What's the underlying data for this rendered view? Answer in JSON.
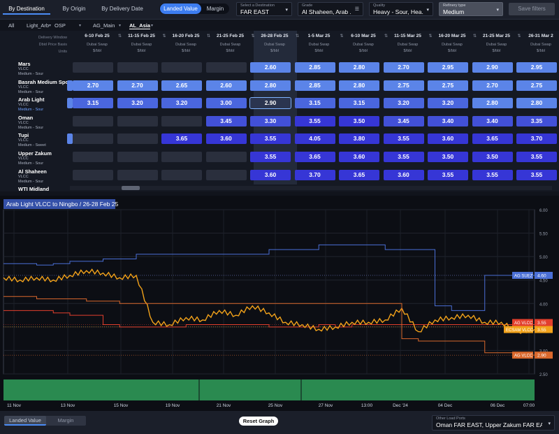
{
  "nav": {
    "by_destination": "By Destination",
    "by_origin": "By Origin",
    "by_delivery_date": "By Delivery Date",
    "landed_value": "Landed Value",
    "margin": "Margin",
    "select_destination_label": "Select a Destination",
    "select_destination_value": "FAR EAST",
    "grade_label": "Grade",
    "grade_value": "Al Shaheen, Arab ...",
    "quality_label": "Quality",
    "quality_value": "Heavy - Sour, Hea...",
    "refinery_label": "Refinery type",
    "refinery_value": "Medium",
    "save_filters": "Save filters"
  },
  "filter_tabs": [
    "All",
    "Light_Arb",
    "OSP",
    "AG_Main",
    "AL_Asia"
  ],
  "grid": {
    "row_header_labels": [
      "Delivery Window",
      "Dbid Price Basis",
      "Units"
    ],
    "columns": [
      {
        "date": "6-10 Feb 25",
        "basis": "Dubai Swap",
        "units": "$/bbl"
      },
      {
        "date": "11-15 Feb 25",
        "basis": "Dubai Swap",
        "units": "$/bbl"
      },
      {
        "date": "16-20 Feb 25",
        "basis": "Dubai Swap",
        "units": "$/bbl"
      },
      {
        "date": "21-25 Feb 25",
        "basis": "Dubai Swap",
        "units": "$/bbl"
      },
      {
        "date": "26-28 Feb 25",
        "basis": "Dubai Swap",
        "units": "$/bbl"
      },
      {
        "date": "1-5 Mar 25",
        "basis": "Dubai Swap",
        "units": "$/bbl"
      },
      {
        "date": "6-10 Mar 25",
        "basis": "Dubai Swap",
        "units": "$/bbl"
      },
      {
        "date": "11-15 Mar 25",
        "basis": "Dubai Swap",
        "units": "$/bbl"
      },
      {
        "date": "16-20 Mar 25",
        "basis": "Dubai Swap",
        "units": "$/bbl"
      },
      {
        "date": "21-25 Mar 25",
        "basis": "Dubai Swap",
        "units": "$/bbl"
      },
      {
        "date": "26-31 Mar 2",
        "basis": "Dubai Swap",
        "units": "$/bbl"
      }
    ],
    "rows": [
      {
        "name": "Mars",
        "type": "VLCC",
        "quality": "Medium - Sour",
        "values": [
          "",
          "",
          "",
          "",
          "2.60",
          "2.85",
          "2.80",
          "2.70",
          "2.95",
          "2.90",
          "2.95"
        ]
      },
      {
        "name": "Basrah Medium Spot",
        "type": "VLCC",
        "quality": "Medium - Sour",
        "values": [
          "2.70",
          "2.70",
          "2.65",
          "2.60",
          "2.80",
          "2.85",
          "2.80",
          "2.75",
          "2.75",
          "2.70",
          "2.75"
        ]
      },
      {
        "name": "Arab Light",
        "type": "VLCC",
        "quality": "Medium - Sour",
        "values": [
          "3.15",
          "3.20",
          "3.20",
          "3.00",
          "2.90",
          "3.15",
          "3.15",
          "3.20",
          "3.20",
          "2.80",
          "2.80"
        ]
      },
      {
        "name": "Oman",
        "type": "VLCC",
        "quality": "Medium - Sour",
        "values": [
          "",
          "",
          "",
          "3.45",
          "3.30",
          "3.55",
          "3.50",
          "3.45",
          "3.40",
          "3.40",
          "3.35"
        ]
      },
      {
        "name": "Tupi",
        "type": "VLCC",
        "quality": "Medium - Sweet",
        "values": [
          "",
          "",
          "3.65",
          "3.60",
          "3.55",
          "4.05",
          "3.80",
          "3.55",
          "3.60",
          "3.65",
          "3.70"
        ]
      },
      {
        "name": "Upper Zakum",
        "type": "VLCC",
        "quality": "Medium - Sour",
        "values": [
          "",
          "",
          "",
          "",
          "3.55",
          "3.65",
          "3.60",
          "3.55",
          "3.50",
          "3.50",
          "3.55"
        ]
      },
      {
        "name": "Al Shaheen",
        "type": "VLCC",
        "quality": "Medium - Sour",
        "values": [
          "",
          "",
          "",
          "",
          "3.60",
          "3.70",
          "3.65",
          "3.60",
          "3.55",
          "3.55",
          "3.55"
        ]
      },
      {
        "name": "WTI Midland",
        "type": "",
        "quality": "",
        "values": []
      }
    ]
  },
  "chart_data": {
    "type": "line",
    "title": "Arab Light VLCC to Ningbo / 26-28 Feb 25",
    "x_ticks": [
      "11 Nov",
      "13 Nov",
      "15 Nov",
      "19 Nov",
      "21 Nov",
      "25 Nov",
      "27 Nov",
      "13:00",
      "Dec '24",
      "04 Dec",
      "06 Dec",
      "07:00"
    ],
    "y_ticks": [
      "6.00",
      "5.50",
      "5.00",
      "4.50",
      "4.00",
      "3.50",
      "3.00",
      "2.50"
    ],
    "ylim": [
      2.5,
      6.0
    ],
    "series": [
      {
        "name": "AG SUEZ",
        "color": "#4a6fd6",
        "values": [
          4.85,
          4.85,
          4.82,
          4.85,
          4.9,
          4.9,
          4.95,
          4.95,
          5.05,
          5.05,
          5.05,
          5.05,
          5.05,
          5.05,
          5.05,
          5.05,
          5.15,
          5.15,
          5.15,
          5.25,
          5.25,
          5.25,
          5.25,
          5.15,
          5.15,
          5.15,
          3.95,
          3.85,
          3.85,
          4.6,
          4.6,
          4.6,
          4.6
        ],
        "last": "4.60"
      },
      {
        "name": "AG VLCC",
        "color": "#e23f2c",
        "values": [
          3.85,
          3.85,
          3.85,
          3.8,
          3.75,
          3.75,
          3.55,
          3.5,
          3.5,
          3.5,
          3.5,
          3.55,
          3.55,
          3.55,
          3.55,
          3.55,
          3.5,
          3.5,
          3.5,
          3.55,
          3.5,
          3.55,
          3.55,
          3.55,
          3.55,
          3.55,
          3.55,
          3.55,
          3.55,
          3.55,
          3.55,
          3.55,
          3.55
        ],
        "last": "3.55"
      },
      {
        "name": "ECSAM VLCC",
        "color": "#f2a21a",
        "values": [
          4.55,
          4.5,
          4.55,
          4.5,
          4.6,
          4.7,
          4.65,
          4.55,
          4.6,
          3.6,
          3.55,
          3.7,
          3.65,
          3.85,
          3.75,
          3.95,
          3.8,
          3.6,
          3.55,
          3.45,
          3.5,
          3.6,
          3.6,
          3.65,
          3.9,
          3.4,
          3.65,
          3.7,
          3.75,
          3.6,
          3.6,
          3.4,
          3.45
        ],
        "last": "3.55"
      },
      {
        "name": "AG VLCC",
        "color": "#d9682c",
        "values": [
          4.15,
          4.15,
          4.1,
          4.1,
          4.1,
          4.05,
          4.05,
          4.0,
          4.0,
          4.0,
          4.0,
          4.0,
          4.0,
          4.0,
          4.0,
          4.0,
          4.0,
          4.0,
          4.0,
          4.0,
          4.0,
          4.0,
          4.0,
          4.0,
          3.25,
          3.2,
          3.2,
          3.2,
          3.2,
          2.95,
          2.95,
          2.9,
          2.9
        ],
        "last": "2.90"
      }
    ],
    "ref_lines": [
      4.6,
      3.55,
      3.5,
      2.9
    ]
  },
  "bottom": {
    "landed_value": "Landed Value",
    "margin": "Margin",
    "reset_graph": "Reset Graph",
    "other_ports_label": "Other Load Ports",
    "other_ports_value": "Oman FAR EAST, Upper Zakum FAR EAS..."
  }
}
